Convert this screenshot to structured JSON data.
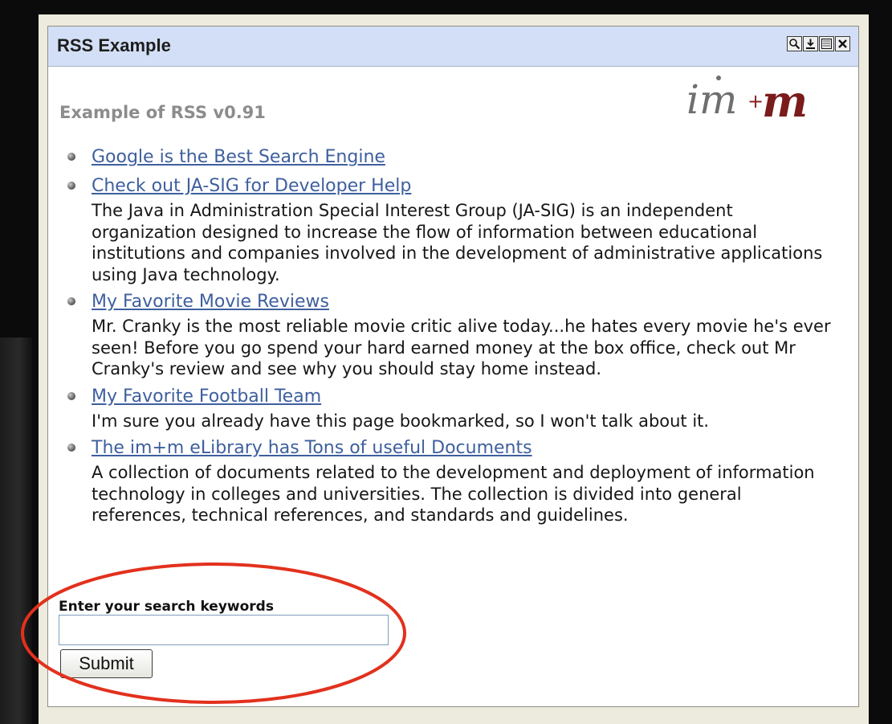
{
  "portlet": {
    "title": "RSS Example",
    "controls": [
      "search-icon",
      "download-icon",
      "maximize-icon",
      "close-icon"
    ]
  },
  "logo": {
    "text": "im+m"
  },
  "feed": {
    "title": "Example of RSS v0.91",
    "items": [
      {
        "title": "Google is the Best Search Engine",
        "description": ""
      },
      {
        "title": "Check out JA-SIG for Developer Help",
        "description": "The Java in Administration Special Interest Group (JA-SIG) is an independent organization designed to increase the flow of information between educational institutions and companies involved in the development of administrative applications using Java technology."
      },
      {
        "title": "My Favorite Movie Reviews",
        "description": "Mr. Cranky is the most reliable movie critic alive today...he hates every movie he's ever seen! Before you go spend your hard earned money at the box office, check out Mr Cranky's review and see why you should stay home instead."
      },
      {
        "title": "My Favorite Football Team",
        "description": "I'm sure you already have this page bookmarked, so I won't talk about it."
      },
      {
        "title": "The im+m eLibrary has Tons of useful Documents",
        "description": "A collection of documents related to the development and deployment of information technology in colleges and universities. The collection is divided into general references, technical references, and standards and guidelines."
      }
    ]
  },
  "search": {
    "label": "Enter your search keywords",
    "value": "",
    "submit_label": "Submit"
  },
  "colors": {
    "titlebar": "#d3dff6",
    "link": "#3e5f9e",
    "annotation": "#e2311d",
    "logo": "#7a1c1c"
  }
}
